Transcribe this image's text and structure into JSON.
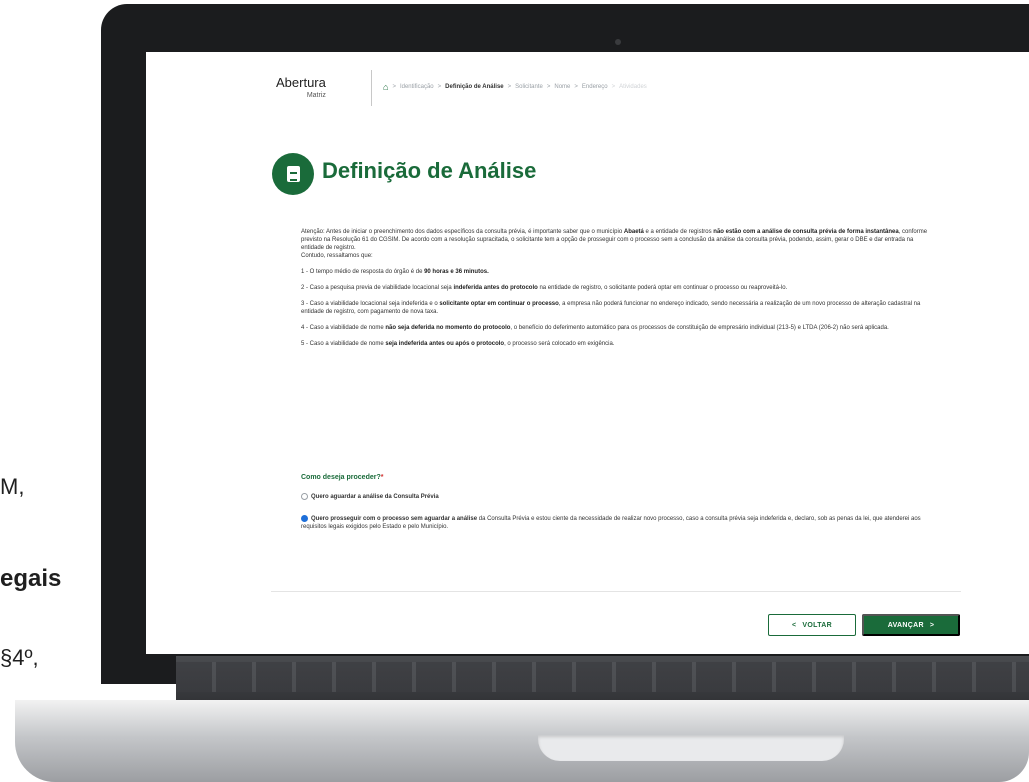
{
  "side_text": {
    "line1": "M,",
    "line2": "egais",
    "line3": "§4º,"
  },
  "header": {
    "brand_title": "Abertura",
    "brand_subtitle": "Matriz",
    "breadcrumb": [
      "Identificação",
      "Definição de Análise",
      "Solicitante",
      "Nome",
      "Endereço",
      "Atividades"
    ],
    "breadcrumb_sep": ">"
  },
  "page": {
    "title": "Definição de Análise",
    "notice_a": "Atenção: Antes de iniciar o preenchimento dos dados específicos da consulta prévia, é importante saber que o município ",
    "notice_b": "Abaetá",
    "notice_c": " e a entidade de registros ",
    "notice_d": "não estão com a análise de consulta prévia de forma instantânea",
    "notice_e": ", conforme previsto na Resolução 61 do CGSIM. De acordo com a resolução supracitada, o solicitante tem a opção de prosseguir com o processo sem a conclusão da análise da consulta prévia, podendo, assim, gerar o DBE e dar entrada na entidade de registro.",
    "notice_f": "Contudo, ressaltamos que:",
    "item1_a": "1 - O tempo médio de resposta do órgão é de ",
    "item1_b": "90 horas e 36 minutos.",
    "item2_a": "2 - Caso a pesquisa previa de viabilidade locacional seja ",
    "item2_b": "indeferida antes do protocolo",
    "item2_c": " na entidade de registro, o solicitante poderá optar em continuar o processo ou reaproveitá-lo.",
    "item3_a": "3 - Caso a viabilidade locacional seja indeferida e o ",
    "item3_b": "solicitante optar em continuar o processo",
    "item3_c": ", a empresa não poderá funcionar no endereço indicado, sendo necessária a realização de um novo processo de alteração cadastral na entidade de registro, com pagamento de nova taxa.",
    "item4_a": "4 - Caso a viabilidade de nome ",
    "item4_b": "não seja deferida no momento do protocolo",
    "item4_c": ", o benefício do deferimento automático para os processos de constituição de empresário individual (213-5) e LTDA (206-2) não será aplicada.",
    "item5_a": "5 - Caso a viabilidade de nome ",
    "item5_b": "seja indeferida antes ou após o protocolo",
    "item5_c": ", o processo será colocado em exigência.",
    "question": "Como deseja proceder?",
    "required_mark": "*",
    "option1": "Quero aguardar a análise da Consulta Prévia",
    "option2_a": "Quero prosseguir com o processo sem aguardar a análise",
    "option2_b": " da Consulta Prévia e estou ciente da necessidade de realizar novo processo, caso a consulta prévia seja indeferida e, declaro, sob as penas da lei, que atenderei aos requisitos legais exigidos pelo Estado e pelo Município.",
    "selected_option": 2
  },
  "actions": {
    "back_label": "VOLTAR",
    "back_icon": "chevron-left-icon",
    "next_label": "AVANÇAR",
    "next_icon": "chevron-right-icon"
  },
  "colors": {
    "brand_green": "#1a6b3a",
    "required_red": "#d32f2f",
    "radio_blue": "#1e6fd9"
  }
}
